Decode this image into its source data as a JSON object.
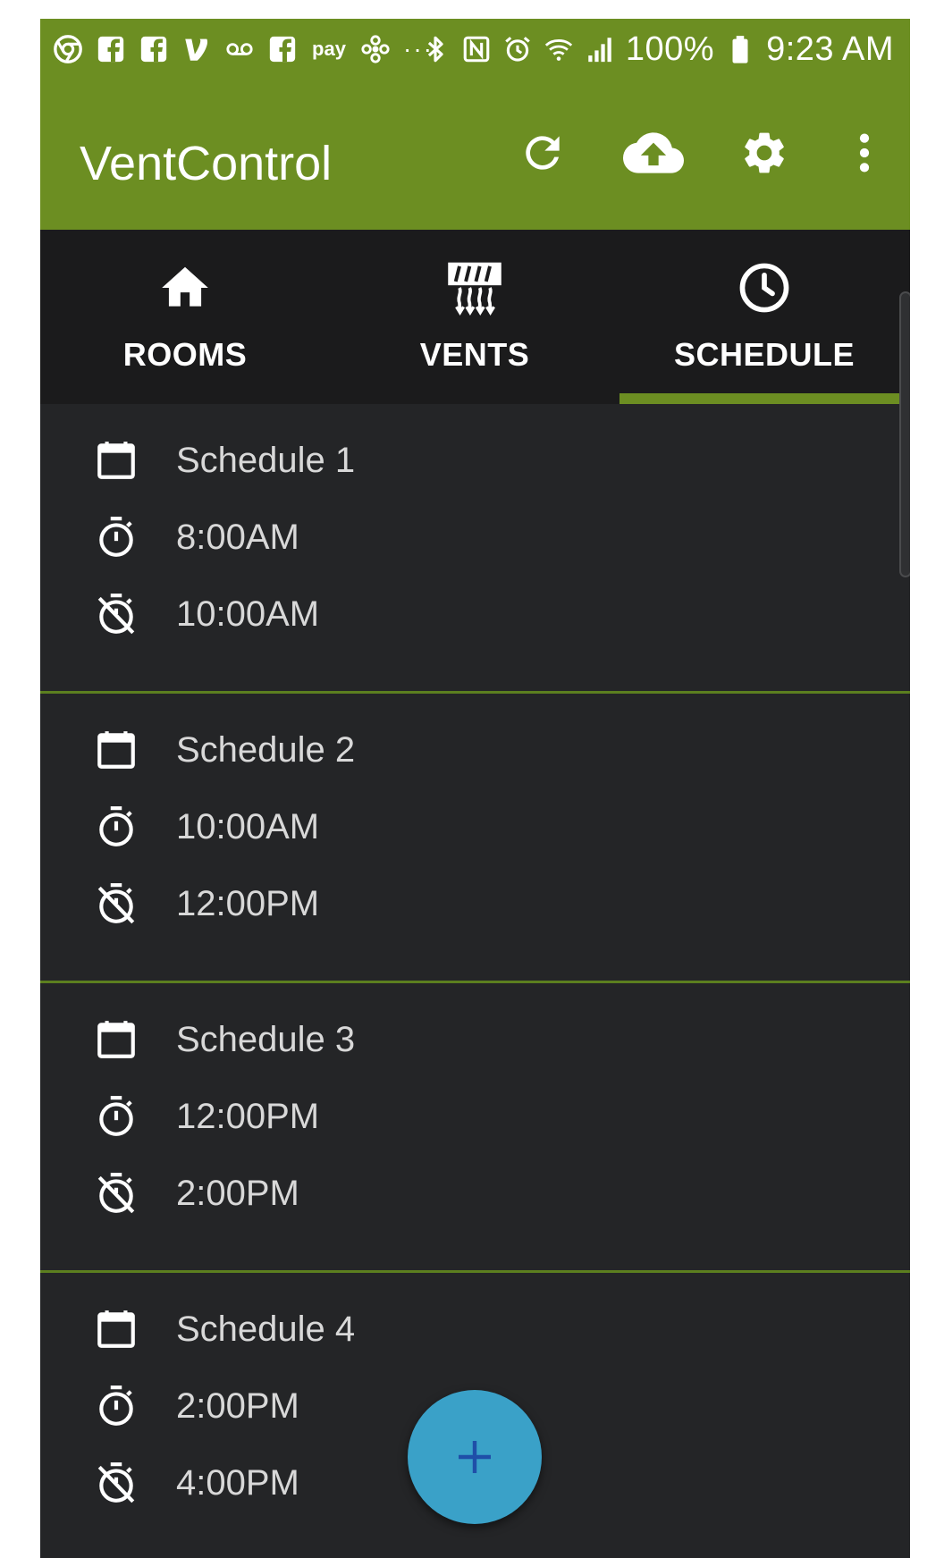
{
  "status_bar": {
    "left_icons": [
      "chrome-icon",
      "facebook-icon",
      "facebook-icon",
      "venmo-icon",
      "voicemail-icon",
      "facebook-icon",
      "samsung-pay-icon",
      "fan-icon",
      "more-dots-icon"
    ],
    "samsung_pay_label": "pay",
    "dots": "···",
    "battery_text": "100%",
    "time": "9:23 AM"
  },
  "app_bar": {
    "title": "VentControl",
    "actions": [
      "refresh-icon",
      "cloud-upload-icon",
      "settings-icon",
      "more-vert-icon"
    ]
  },
  "tabs": [
    {
      "label": "ROOMS",
      "icon": "home-icon",
      "selected": false
    },
    {
      "label": "VENTS",
      "icon": "vent-icon",
      "selected": false
    },
    {
      "label": "SCHEDULE",
      "icon": "clock-icon",
      "selected": true
    }
  ],
  "schedules": [
    {
      "name": "Schedule 1",
      "start": "8:00AM",
      "end": "10:00AM"
    },
    {
      "name": "Schedule 2",
      "start": "10:00AM",
      "end": "12:00PM"
    },
    {
      "name": "Schedule 3",
      "start": "12:00PM",
      "end": "2:00PM"
    },
    {
      "name": "Schedule 4",
      "start": "2:00PM",
      "end": "4:00PM"
    }
  ],
  "colors": {
    "primary": "#6c8e22",
    "tab_bar": "#1b1b1c",
    "background": "#242527",
    "fab": "#3aa1c8",
    "fab_icon": "#1f4fa8"
  },
  "fab": {
    "icon": "plus-icon"
  }
}
